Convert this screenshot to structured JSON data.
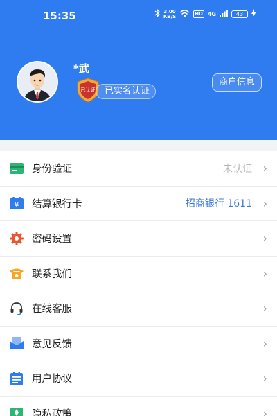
{
  "status": {
    "time": "15:35",
    "speed_top": "3.00",
    "speed_unit": "KB/S",
    "hd": "HD",
    "signal": "4G",
    "battery": "43"
  },
  "profile": {
    "name": "*武",
    "verified_label": "已实名认证",
    "merchant_button": "商户信息",
    "badge_text": "已认证"
  },
  "menu": [
    {
      "label": "身份验证",
      "value": "未认证",
      "icon": "id-card-icon",
      "color": "#2bb673"
    },
    {
      "label": "结算银行卡",
      "value": "招商银行 1611",
      "icon": "bank-card-icon",
      "color": "#2f7bf0"
    },
    {
      "label": "密码设置",
      "value": "",
      "icon": "gear-icon",
      "color": "#e8552f"
    },
    {
      "label": "联系我们",
      "value": "",
      "icon": "phone-icon",
      "color": "#f5a623"
    },
    {
      "label": "在线客服",
      "value": "",
      "icon": "headset-icon",
      "color": "#333333"
    },
    {
      "label": "意见反馈",
      "value": "",
      "icon": "mail-icon",
      "color": "#2f7bf0"
    },
    {
      "label": "用户协议",
      "value": "",
      "icon": "document-icon",
      "color": "#2f7bf0"
    },
    {
      "label": "隐私政策",
      "value": "",
      "icon": "privacy-icon",
      "color": "#2bb673"
    }
  ]
}
